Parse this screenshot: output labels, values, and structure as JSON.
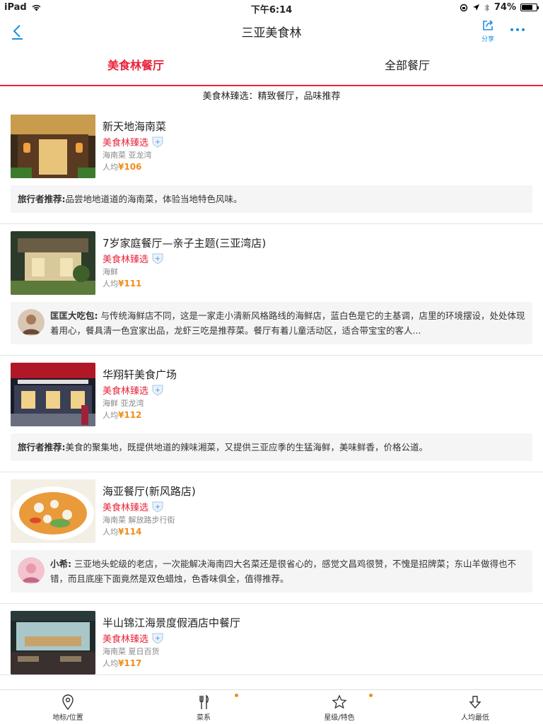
{
  "status_bar": {
    "device": "iPad",
    "time": "下午6:14",
    "battery": "74%",
    "battery_level": 0.74
  },
  "navbar": {
    "title": "三亚美食林",
    "share_label": "分享"
  },
  "tabs": [
    {
      "label": "美食林餐厅",
      "active": true
    },
    {
      "label": "全部餐厅",
      "active": false
    }
  ],
  "banner": "美食林臻选：精致餐厅，品味推荐",
  "colors": {
    "accent": "#e8233a",
    "price": "#f08c1c",
    "link": "#1a8fe0"
  },
  "restaurants": [
    {
      "name": "新天地海南菜",
      "tag": "美食林臻选",
      "category": "海南菜 亚龙湾",
      "price_prefix": "人均",
      "price": "¥106",
      "review_author": "旅行者推荐:",
      "review_text": "品尝地地道道的海南菜，体验当地特色风味。"
    },
    {
      "name": "7岁家庭餐厅—亲子主题(三亚湾店)",
      "tag": "美食林臻选",
      "category": "海鲜",
      "price_prefix": "人均",
      "price": "¥111",
      "review_author": "匡匡大吃包:",
      "review_text": " 与传统海鲜店不同，这是一家走小清新风格路线的海鲜店，蓝白色是它的主基调，店里的环境摆设，处处体现着用心，餐具清一色宜家出品，龙虾三吃是推荐菜。餐厅有着儿童活动区，适合带宝宝的客人..."
    },
    {
      "name": "华翔轩美食广场",
      "tag": "美食林臻选",
      "category": "海鲜 亚龙湾",
      "price_prefix": "人均",
      "price": "¥112",
      "review_author": "旅行者推荐:",
      "review_text": "美食的聚集地，既提供地道的辣味湘菜，又提供三亚应季的生猛海鲜，美味鲜香，价格公道。"
    },
    {
      "name": "海亚餐厅(新风路店)",
      "tag": "美食林臻选",
      "category": "海南菜 解放路步行街",
      "price_prefix": "人均",
      "price": "¥114",
      "review_author": "小希:",
      "review_text": " 三亚地头蛇级的老店，一次能解决海南四大名菜还是很省心的，感觉文昌鸡很赞，不愧是招牌菜；东山羊做得也不错，而且底座下面竟然是双色蜡烛，色香味俱全，值得推荐。"
    },
    {
      "name": "半山锦江海景度假酒店中餐厅",
      "tag": "美食林臻选",
      "category": "海南菜 夏日百货",
      "price_prefix": "人均",
      "price": "¥117"
    }
  ],
  "bottom_bar": [
    {
      "label": "地标/位置",
      "icon": "location-pin-icon",
      "dot": false
    },
    {
      "label": "菜系",
      "icon": "fork-knife-icon",
      "dot": true
    },
    {
      "label": "星级/特色",
      "icon": "star-icon",
      "dot": true
    },
    {
      "label": "人均最低",
      "icon": "arrow-down-icon",
      "dot": false
    }
  ]
}
